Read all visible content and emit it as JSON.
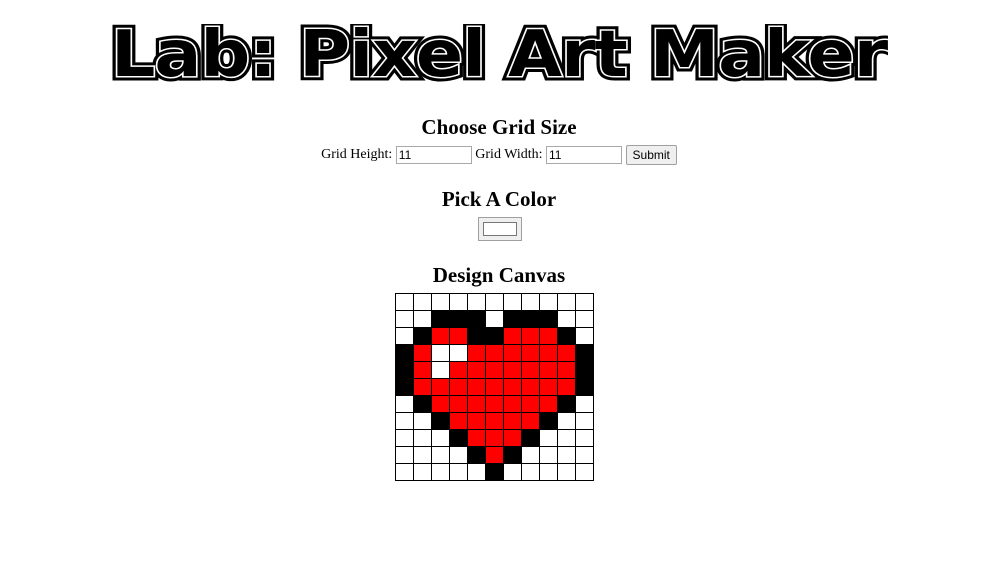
{
  "logo": {
    "title": "Lab: Pixel Art Maker"
  },
  "grid_section": {
    "heading": "Choose Grid Size",
    "height_label": "Grid Height:",
    "height_value": "11",
    "width_label": "Grid Width:",
    "width_value": "11",
    "submit_label": "Submit"
  },
  "color_section": {
    "heading": "Pick A Color",
    "selected_color": "#ffffff"
  },
  "canvas_section": {
    "heading": "Design Canvas",
    "rows": 11,
    "cols": 11,
    "palette": {
      "W": "#ffffff",
      "B": "#000000",
      "R": "#ff0000"
    },
    "pixels": [
      "WWWWWWWWWWW",
      "WWBBBWBBBWW",
      "WBRRBBRRRBW",
      "BRWWRRRRRRB",
      "BRWRRRRRRRB",
      "BRRRRRRRRRB",
      "WBRRRRRRRBW",
      "WWBRRRRRBWW",
      "WWWBRRRBWWW",
      "WWWWBRBWWWW",
      "WWWWWBWWWWW"
    ]
  }
}
